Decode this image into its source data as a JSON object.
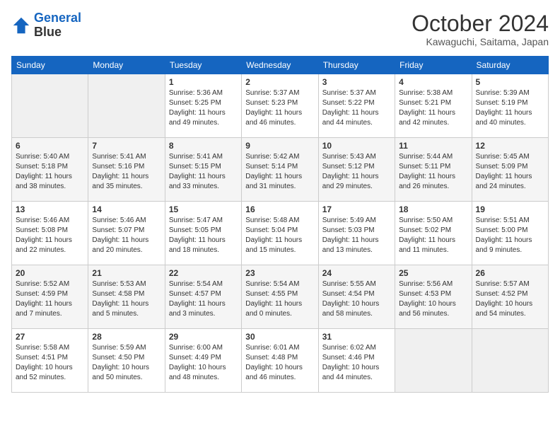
{
  "header": {
    "logo_line1": "General",
    "logo_line2": "Blue",
    "month": "October 2024",
    "location": "Kawaguchi, Saitama, Japan"
  },
  "days_of_week": [
    "Sunday",
    "Monday",
    "Tuesday",
    "Wednesday",
    "Thursday",
    "Friday",
    "Saturday"
  ],
  "weeks": [
    [
      {
        "day": "",
        "info": ""
      },
      {
        "day": "",
        "info": ""
      },
      {
        "day": "1",
        "info": "Sunrise: 5:36 AM\nSunset: 5:25 PM\nDaylight: 11 hours and 49 minutes."
      },
      {
        "day": "2",
        "info": "Sunrise: 5:37 AM\nSunset: 5:23 PM\nDaylight: 11 hours and 46 minutes."
      },
      {
        "day": "3",
        "info": "Sunrise: 5:37 AM\nSunset: 5:22 PM\nDaylight: 11 hours and 44 minutes."
      },
      {
        "day": "4",
        "info": "Sunrise: 5:38 AM\nSunset: 5:21 PM\nDaylight: 11 hours and 42 minutes."
      },
      {
        "day": "5",
        "info": "Sunrise: 5:39 AM\nSunset: 5:19 PM\nDaylight: 11 hours and 40 minutes."
      }
    ],
    [
      {
        "day": "6",
        "info": "Sunrise: 5:40 AM\nSunset: 5:18 PM\nDaylight: 11 hours and 38 minutes."
      },
      {
        "day": "7",
        "info": "Sunrise: 5:41 AM\nSunset: 5:16 PM\nDaylight: 11 hours and 35 minutes."
      },
      {
        "day": "8",
        "info": "Sunrise: 5:41 AM\nSunset: 5:15 PM\nDaylight: 11 hours and 33 minutes."
      },
      {
        "day": "9",
        "info": "Sunrise: 5:42 AM\nSunset: 5:14 PM\nDaylight: 11 hours and 31 minutes."
      },
      {
        "day": "10",
        "info": "Sunrise: 5:43 AM\nSunset: 5:12 PM\nDaylight: 11 hours and 29 minutes."
      },
      {
        "day": "11",
        "info": "Sunrise: 5:44 AM\nSunset: 5:11 PM\nDaylight: 11 hours and 26 minutes."
      },
      {
        "day": "12",
        "info": "Sunrise: 5:45 AM\nSunset: 5:09 PM\nDaylight: 11 hours and 24 minutes."
      }
    ],
    [
      {
        "day": "13",
        "info": "Sunrise: 5:46 AM\nSunset: 5:08 PM\nDaylight: 11 hours and 22 minutes."
      },
      {
        "day": "14",
        "info": "Sunrise: 5:46 AM\nSunset: 5:07 PM\nDaylight: 11 hours and 20 minutes."
      },
      {
        "day": "15",
        "info": "Sunrise: 5:47 AM\nSunset: 5:05 PM\nDaylight: 11 hours and 18 minutes."
      },
      {
        "day": "16",
        "info": "Sunrise: 5:48 AM\nSunset: 5:04 PM\nDaylight: 11 hours and 15 minutes."
      },
      {
        "day": "17",
        "info": "Sunrise: 5:49 AM\nSunset: 5:03 PM\nDaylight: 11 hours and 13 minutes."
      },
      {
        "day": "18",
        "info": "Sunrise: 5:50 AM\nSunset: 5:02 PM\nDaylight: 11 hours and 11 minutes."
      },
      {
        "day": "19",
        "info": "Sunrise: 5:51 AM\nSunset: 5:00 PM\nDaylight: 11 hours and 9 minutes."
      }
    ],
    [
      {
        "day": "20",
        "info": "Sunrise: 5:52 AM\nSunset: 4:59 PM\nDaylight: 11 hours and 7 minutes."
      },
      {
        "day": "21",
        "info": "Sunrise: 5:53 AM\nSunset: 4:58 PM\nDaylight: 11 hours and 5 minutes."
      },
      {
        "day": "22",
        "info": "Sunrise: 5:54 AM\nSunset: 4:57 PM\nDaylight: 11 hours and 3 minutes."
      },
      {
        "day": "23",
        "info": "Sunrise: 5:54 AM\nSunset: 4:55 PM\nDaylight: 11 hours and 0 minutes."
      },
      {
        "day": "24",
        "info": "Sunrise: 5:55 AM\nSunset: 4:54 PM\nDaylight: 10 hours and 58 minutes."
      },
      {
        "day": "25",
        "info": "Sunrise: 5:56 AM\nSunset: 4:53 PM\nDaylight: 10 hours and 56 minutes."
      },
      {
        "day": "26",
        "info": "Sunrise: 5:57 AM\nSunset: 4:52 PM\nDaylight: 10 hours and 54 minutes."
      }
    ],
    [
      {
        "day": "27",
        "info": "Sunrise: 5:58 AM\nSunset: 4:51 PM\nDaylight: 10 hours and 52 minutes."
      },
      {
        "day": "28",
        "info": "Sunrise: 5:59 AM\nSunset: 4:50 PM\nDaylight: 10 hours and 50 minutes."
      },
      {
        "day": "29",
        "info": "Sunrise: 6:00 AM\nSunset: 4:49 PM\nDaylight: 10 hours and 48 minutes."
      },
      {
        "day": "30",
        "info": "Sunrise: 6:01 AM\nSunset: 4:48 PM\nDaylight: 10 hours and 46 minutes."
      },
      {
        "day": "31",
        "info": "Sunrise: 6:02 AM\nSunset: 4:46 PM\nDaylight: 10 hours and 44 minutes."
      },
      {
        "day": "",
        "info": ""
      },
      {
        "day": "",
        "info": ""
      }
    ]
  ]
}
